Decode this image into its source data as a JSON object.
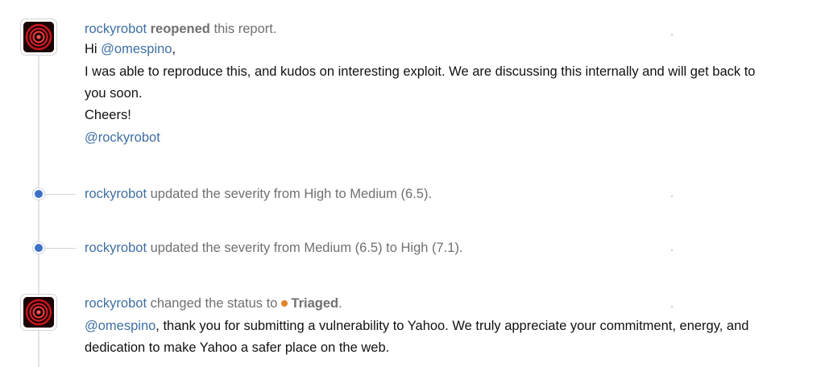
{
  "activities": [
    {
      "type": "comment",
      "actor": "rockyrobot",
      "action": "reopened",
      "action_suffix": " this report.",
      "body": {
        "greeting": "Hi ",
        "mention": "@omespino",
        "greeting_end": ",",
        "line1": "I was able to reproduce this, and kudos on interesting exploit. We are discussing this internally and will get back to",
        "line2": "you soon.",
        "line3": "Cheers!",
        "signature": "@rockyrobot"
      }
    },
    {
      "type": "event",
      "actor": "rockyrobot",
      "text": " updated the severity from High to Medium (6.5)."
    },
    {
      "type": "event",
      "actor": "rockyrobot",
      "text": " updated the severity from Medium (6.5) to High (7.1)."
    },
    {
      "type": "comment",
      "actor": "rockyrobot",
      "action_prefix": " changed the status to",
      "status": "Triaged",
      "status_end": ".",
      "status_color": "#e2842b",
      "body": {
        "mention": "@omespino",
        "line1_rest": ", thank you for submitting a vulnerability to Yahoo. We truly appreciate your commitment, energy, and",
        "line2": "dedication to make Yahoo a safer place on the web."
      }
    }
  ],
  "icons": {
    "avatar": "rockyrobot-avatar-icon",
    "timeline_dot": "timeline-dot-icon",
    "status": "status-dot-icon"
  },
  "colors": {
    "link": "#3f6fa3",
    "muted": "#707070",
    "timeline_dot": "#3d71c8"
  }
}
